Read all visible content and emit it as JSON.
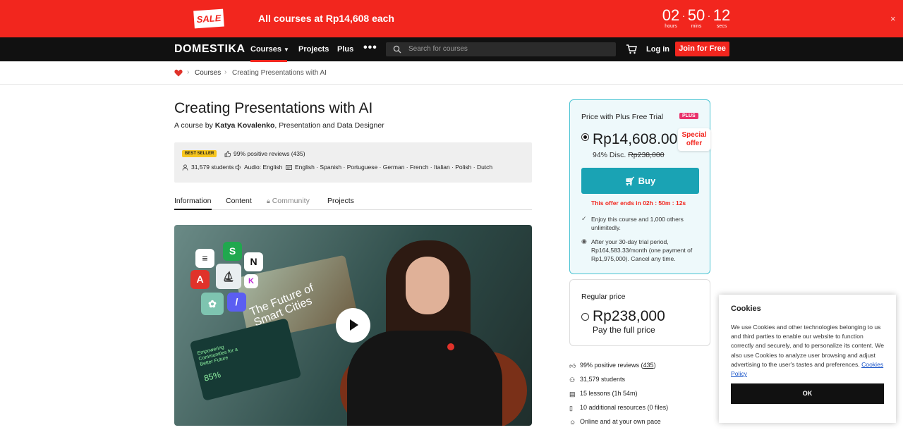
{
  "promo": {
    "sale_label": "SALE",
    "text": "All courses at Rp14,608 each",
    "timer": {
      "hours": "02",
      "hours_label": "hours",
      "mins": "50",
      "mins_label": "mins",
      "secs": "12",
      "secs_label": "secs"
    },
    "close": "×"
  },
  "nav": {
    "logo": "DOMESTIKA",
    "courses": "Courses",
    "projects": "Projects",
    "plus": "Plus",
    "more": "•••",
    "search_placeholder": "Search for courses",
    "login": "Log in",
    "join": "Join for Free"
  },
  "breadcrumb": {
    "courses": "Courses",
    "current": "Creating Presentations with AI"
  },
  "course": {
    "title": "Creating Presentations with AI",
    "byline_prefix": "A course by",
    "author": "Katya Kovalenko",
    "byline_suffix": ", Presentation and Data Designer",
    "badge": "BEST SELLER",
    "reviews": "99% positive reviews (435)",
    "students": "31,579 students",
    "audio": "Audio: English",
    "subtitles": "English · Spanish · Portuguese · German · French · Italian · Polish · Dutch"
  },
  "tabs": [
    "Information",
    "Content",
    "Community",
    "Projects"
  ],
  "video": {
    "card_title": "The Future of Smart Cities",
    "card2_title": "Empowering Communities for a Better Future",
    "card2_pct": "85%"
  },
  "plus_panel": {
    "title": "Price with Plus Free Trial",
    "badge": "PLUS",
    "price": "Rp14,608.00",
    "discount": "94% Disc.",
    "original": "Rp238,000",
    "special": "Special offer",
    "buy": "Buy",
    "offer_ends": "This offer ends in 02h : 50m : 12s",
    "note1": "Enjoy this course and 1,000 others unlimitedly.",
    "note2": "After your 30-day trial period, Rp164,583.33/month (one payment of Rp1,975,000). Cancel any time."
  },
  "regular_panel": {
    "title": "Regular price",
    "price": "Rp238,000",
    "sub": "Pay the full price"
  },
  "features": {
    "reviews_prefix": "99% positive reviews (",
    "reviews_count": "435",
    "reviews_suffix": ")",
    "students": "31,579 students",
    "lessons": "15 lessons (1h 54m)",
    "resources": "10 additional resources (0 files)",
    "pace": "Online and at your own pace"
  },
  "cookies": {
    "title": "Cookies",
    "text": "We use Cookies and other technologies belonging to us and third parties to enable our website to function correctly and securely, and to personalize its content. We also use Cookies to analyze user browsing and adjust advertising to the user's tastes and preferences.",
    "link": "Cookies Policy",
    "ok": "OK"
  },
  "colors": {
    "brand_red": "#f2261e",
    "teal": "#1aa3b4",
    "plus_pink": "#e8316b",
    "badge_yellow": "#f7c61e"
  }
}
